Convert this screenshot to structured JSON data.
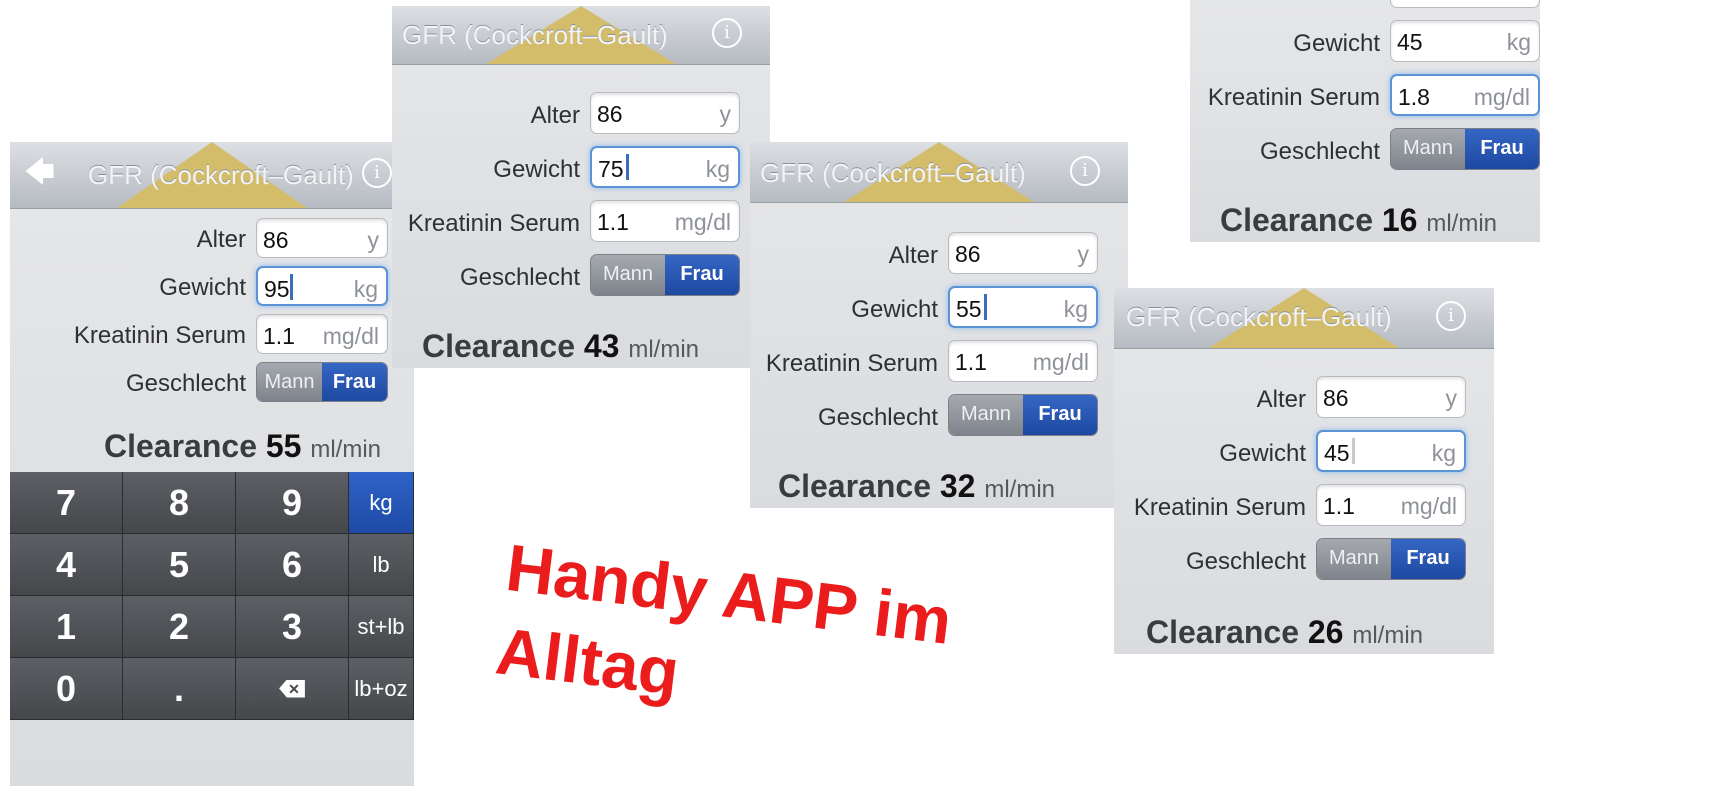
{
  "app": {
    "title": "GFR (Cockcroft–Gault)",
    "info_icon": "info-icon",
    "back_icon": "back-arrow-icon",
    "labels": {
      "age": "Alter",
      "weight": "Gewicht",
      "creatinine": "Kreatinin Serum",
      "sex": "Geschlecht"
    },
    "units": {
      "age": "y",
      "weight": "kg",
      "creatinine": "mg/dl"
    },
    "sex_options": {
      "male": "Mann",
      "female": "Frau"
    },
    "selected_sex": "Frau",
    "clearance_label": "Clearance",
    "clearance_unit": "ml/min"
  },
  "screens": [
    {
      "id": "screen-1",
      "age": "86",
      "weight": "95",
      "creatinine": "1.1",
      "clearance": "55"
    },
    {
      "id": "screen-2",
      "age": "86",
      "weight": "75",
      "creatinine": "1.1",
      "clearance": "43"
    },
    {
      "id": "screen-3",
      "age": "86",
      "weight": "55",
      "creatinine": "1.1",
      "clearance": "32"
    },
    {
      "id": "screen-4",
      "age": "86",
      "weight": "45",
      "creatinine": "1.1",
      "clearance": "26"
    },
    {
      "id": "screen-5",
      "weight": "45",
      "creatinine": "1.8",
      "clearance": "16"
    }
  ],
  "keypad": {
    "rows": [
      [
        "7",
        "8",
        "9",
        "kg"
      ],
      [
        "4",
        "5",
        "6",
        "lb"
      ],
      [
        "1",
        "2",
        "3",
        "st+lb"
      ],
      [
        "0",
        ".",
        "backspace",
        "lb+oz"
      ]
    ],
    "selected_unit": "kg",
    "backspace_icon": "backspace-icon"
  },
  "caption": "Handy APP im\nAlltag",
  "colors": {
    "caption": "#ea1c1c",
    "segment_selected": "#1e49a1",
    "focus_ring": "#5a93d6",
    "keypad_bg": "#45474b"
  }
}
